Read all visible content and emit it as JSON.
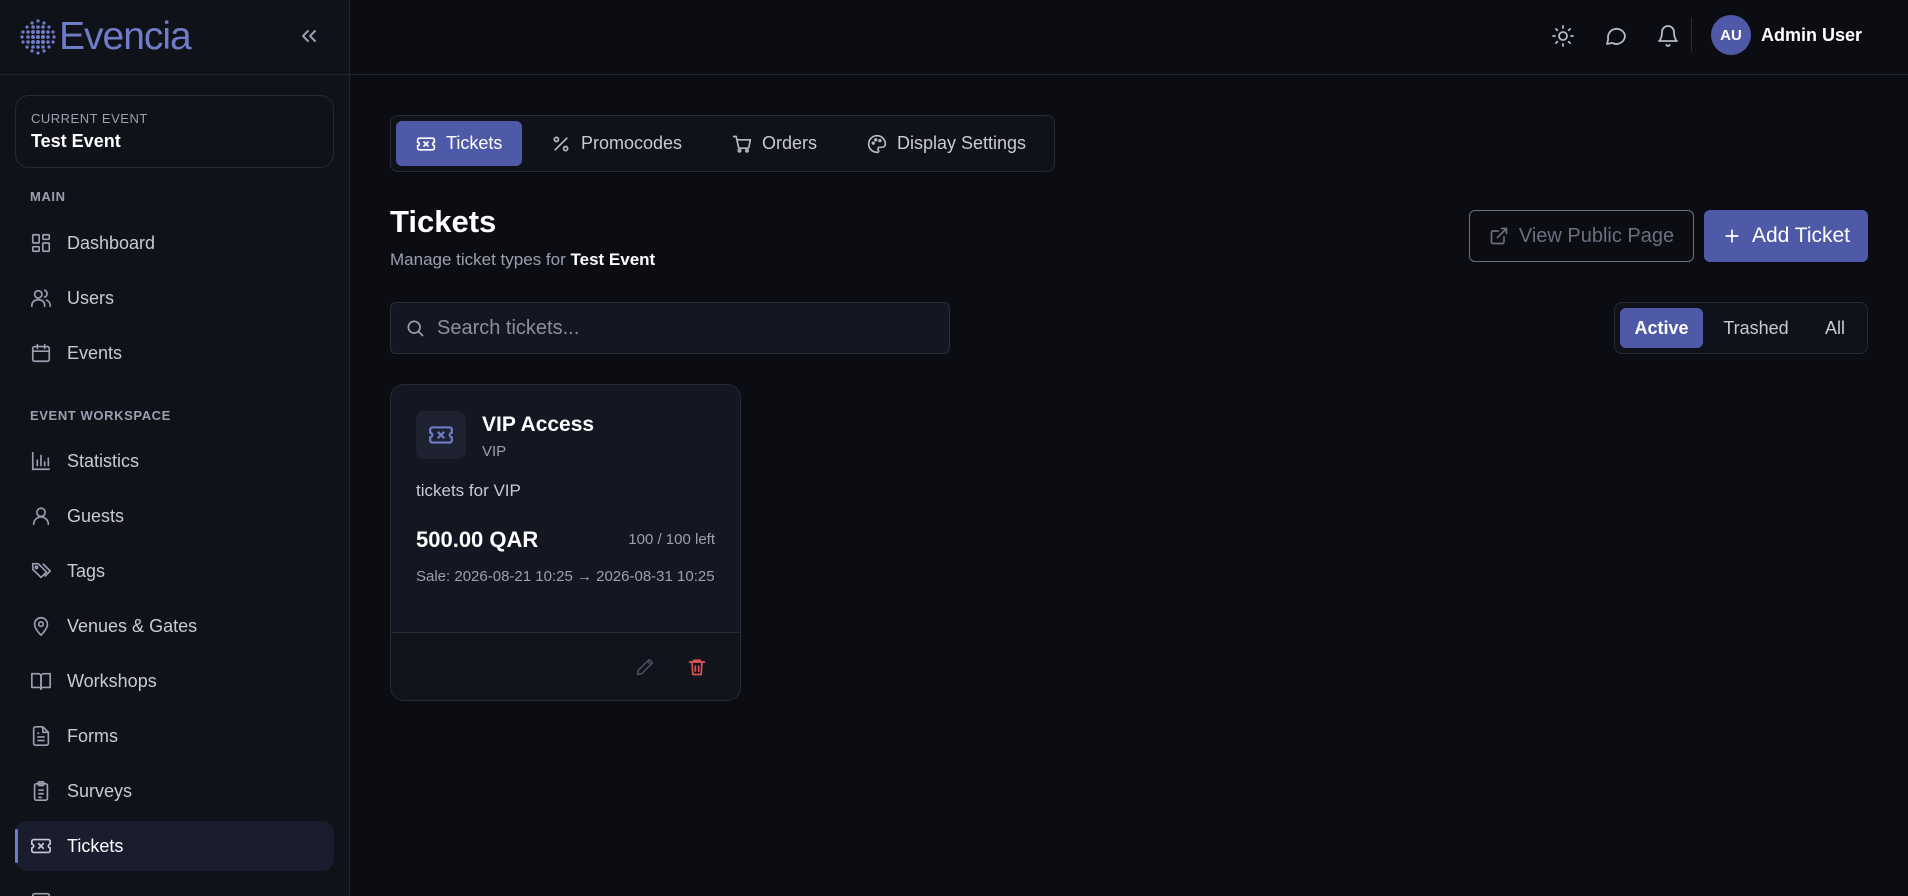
{
  "brand": {
    "name": "Evencia",
    "logo_color": "#6f7dc8"
  },
  "sidebar": {
    "current_event_label": "CURRENT EVENT",
    "current_event_name": "Test Event",
    "main_label": "MAIN",
    "main_items": [
      {
        "label": "Dashboard",
        "icon": "dashboard-icon"
      },
      {
        "label": "Users",
        "icon": "users-icon"
      },
      {
        "label": "Events",
        "icon": "calendar-icon"
      }
    ],
    "workspace_label": "EVENT WORKSPACE",
    "workspace_items": [
      {
        "label": "Statistics",
        "icon": "bar-chart-icon"
      },
      {
        "label": "Guests",
        "icon": "user-icon"
      },
      {
        "label": "Tags",
        "icon": "tags-icon"
      },
      {
        "label": "Venues & Gates",
        "icon": "map-pin-icon"
      },
      {
        "label": "Workshops",
        "icon": "book-icon"
      },
      {
        "label": "Forms",
        "icon": "file-text-icon"
      },
      {
        "label": "Surveys",
        "icon": "clipboard-icon"
      },
      {
        "label": "Tickets",
        "icon": "ticket-icon",
        "active": true
      }
    ]
  },
  "topbar": {
    "user_initials": "AU",
    "user_name": "Admin User"
  },
  "tabs": [
    {
      "label": "Tickets",
      "icon": "ticket-icon",
      "active": true
    },
    {
      "label": "Promocodes",
      "icon": "percent-icon"
    },
    {
      "label": "Orders",
      "icon": "cart-icon"
    },
    {
      "label": "Display Settings",
      "icon": "palette-icon"
    }
  ],
  "page": {
    "title": "Tickets",
    "subtitle_prefix": "Manage ticket types for",
    "subtitle_event": "Test Event",
    "view_public_label": "View Public Page",
    "add_ticket_label": "Add Ticket"
  },
  "search": {
    "placeholder": "Search tickets...",
    "value": ""
  },
  "filters": [
    {
      "label": "Active",
      "active": true
    },
    {
      "label": "Trashed"
    },
    {
      "label": "All"
    }
  ],
  "tickets": [
    {
      "name": "VIP Access",
      "code": "VIP",
      "description": "tickets for VIP",
      "price": "500.00 QAR",
      "availability": "100 / 100 left",
      "sale": "Sale: 2026-08-21 10:25 → 2026-08-31 10:25"
    }
  ],
  "colors": {
    "accent": "#4e5aa8",
    "background": "#0b0d13",
    "danger": "#e05252"
  }
}
